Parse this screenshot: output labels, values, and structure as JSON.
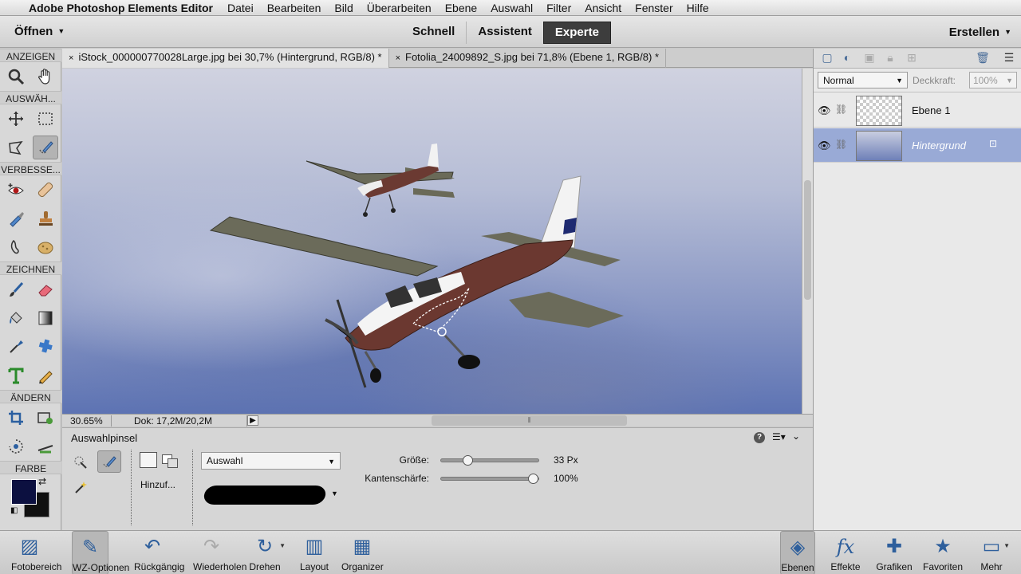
{
  "menubar": {
    "app_name": "Adobe Photoshop Elements Editor",
    "menus": [
      "Datei",
      "Bearbeiten",
      "Bild",
      "Überarbeiten",
      "Ebene",
      "Auswahl",
      "Filter",
      "Ansicht",
      "Fenster",
      "Hilfe"
    ]
  },
  "modebar": {
    "open_label": "Öffnen",
    "modes": [
      "Schnell",
      "Assistent",
      "Experte"
    ],
    "active_mode": "Experte",
    "create_label": "Erstellen"
  },
  "toolbox": {
    "sections": [
      "ANZEIGEN",
      "AUSWÄH...",
      "VERBESSE...",
      "ZEICHNEN",
      "ÄNDERN",
      "FARBE"
    ],
    "foreground_color": "#0c1040",
    "background_color": "#111111",
    "tools": {
      "view": [
        "zoom-icon",
        "hand-icon"
      ],
      "select1": [
        "move-icon",
        "marquee-icon"
      ],
      "select2": [
        "lasso-icon",
        "selection-brush-icon"
      ],
      "enhance1": [
        "red-eye-icon",
        "healing-brush-icon"
      ],
      "enhance2": [
        "smart-brush-icon",
        "clone-stamp-icon"
      ],
      "enhance3": [
        "blur-icon",
        "sponge-icon"
      ],
      "draw1": [
        "brush-icon",
        "eraser-icon"
      ],
      "draw2": [
        "paint-bucket-icon",
        "gradient-icon"
      ],
      "draw3": [
        "eyedropper-icon",
        "custom-shape-icon"
      ],
      "draw4": [
        "type-icon",
        "pencil-icon"
      ],
      "modify1": [
        "crop-icon",
        "recompose-icon"
      ],
      "modify2": [
        "content-aware-move-icon",
        "straighten-icon"
      ]
    }
  },
  "documents": {
    "tabs": [
      "iStock_000000770028Large.jpg bei 30,7% (Hintergrund, RGB/8) *",
      "Fotolia_24009892_S.jpg bei 71,8% (Ebene 1, RGB/8) *"
    ],
    "close_glyph": "×"
  },
  "status": {
    "zoom": "30.65%",
    "doc_info": "Dok: 17,2M/20,2M"
  },
  "options": {
    "tool_name": "Auswahlpinsel",
    "mode_label": "Hinzuf...",
    "brush_mode": "Auswahl",
    "size_label": "Größe:",
    "size_value": "33 Px",
    "size_fraction": 0.25,
    "hardness_label": "Kantenschärfe:",
    "hardness_value": "100%",
    "hardness_fraction": 1.0
  },
  "layers": {
    "blend_mode": "Normal",
    "opacity_label": "Deckkraft:",
    "opacity_value": "100%",
    "items": [
      {
        "name": "Ebene 1",
        "selected": false
      },
      {
        "name": "Hintergrund",
        "selected": true
      }
    ]
  },
  "taskbar": {
    "left": [
      "Fotobereich",
      "WZ-Optionen",
      "Rückgängig",
      "Wiederholen",
      "Drehen",
      "Layout",
      "Organizer"
    ],
    "right": [
      "Ebenen",
      "Effekte",
      "Grafiken",
      "Favoriten",
      "Mehr"
    ]
  }
}
